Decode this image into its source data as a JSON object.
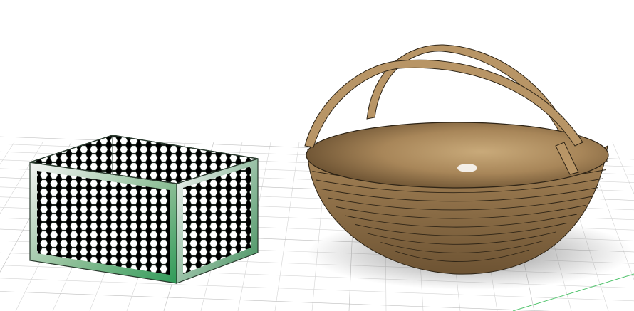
{
  "viewport": {
    "background_color": "#ffffff",
    "grid_color": "#d4d4d4",
    "grid_major_color": "#bdbdbd",
    "axis_green_color": "#4fc36b"
  },
  "objects": {
    "hex_basket": {
      "icon": "hexagon-mesh-basket-icon",
      "frame_colors": [
        "#f4f4f4",
        "#8fbf98",
        "#2f9b58",
        "#3e8e59"
      ],
      "edge_color": "#2a3a2e",
      "hole_color": "#ffffff"
    },
    "wood_basket": {
      "icon": "wooden-bowl-basket-icon",
      "bowl_color": "#a88659",
      "bowl_light_color": "#c9aa7a",
      "bowl_dark_color": "#6d5333",
      "handle_color": "#b89566",
      "stroke_color": "#2e2416",
      "shadow_color": "#6a6a6a"
    }
  }
}
